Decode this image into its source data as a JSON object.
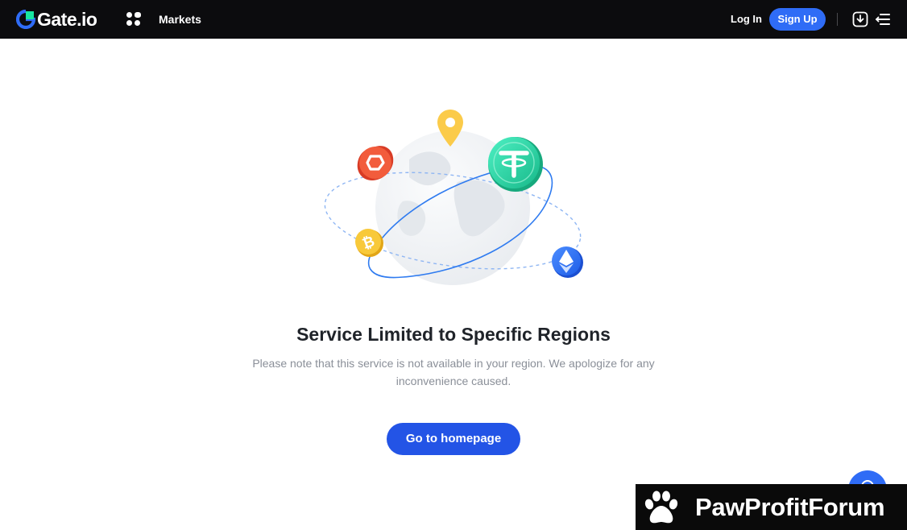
{
  "header": {
    "brand": "Gate.io",
    "apps_icon": "apps-grid-icon",
    "nav": {
      "markets_label": "Markets"
    },
    "login_label": "Log In",
    "signup_label": "Sign Up",
    "download_icon": "download-icon",
    "menu_icon": "menu-icon"
  },
  "main": {
    "title": "Service Limited to Specific Regions",
    "description": "Please note that this service is not available in your region. We apologize for any inconvenience caused.",
    "button_label": "Go to homepage"
  },
  "support": {
    "icon": "chat-support-icon"
  },
  "watermark": {
    "text": "PawProfitForum",
    "icon": "paw-icon"
  },
  "colors": {
    "header_bg": "#0c0c0e",
    "primary": "#2f6cf6",
    "button": "#2354e6",
    "title": "#1f2329",
    "description": "#8a8f98"
  }
}
